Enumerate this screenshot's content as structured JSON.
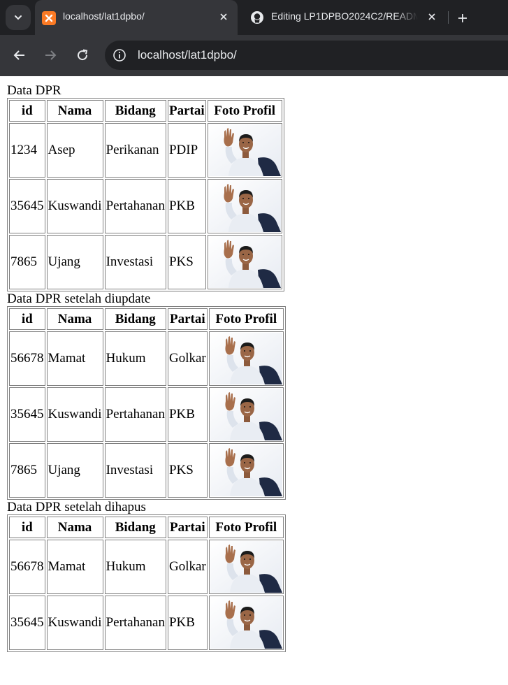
{
  "browser": {
    "tabs": [
      {
        "title": "localhost/lat1dpbo/",
        "active": true,
        "icon": "xampp-icon"
      },
      {
        "title": "Editing LP1DPBO2024C2/README.md",
        "active": false,
        "icon": "github-icon"
      }
    ],
    "url": "localhost/lat1dpbo/",
    "colors": {
      "chrome_bg": "#202124",
      "tab_active": "#35363a",
      "text": "#e8eaed",
      "xampp": "#fb7a24"
    }
  },
  "page": {
    "columns": [
      "id",
      "Nama",
      "Bidang",
      "Partai",
      "Foto Profil"
    ],
    "sections": [
      {
        "caption": "Data DPR",
        "rows": [
          {
            "id": "1234",
            "nama": "Asep",
            "bidang": "Perikanan",
            "partai": "PDIP"
          },
          {
            "id": "35645",
            "nama": "Kuswandi",
            "bidang": "Pertahanan",
            "partai": "PKB"
          },
          {
            "id": "7865",
            "nama": "Ujang",
            "bidang": "Investasi",
            "partai": "PKS"
          }
        ]
      },
      {
        "caption": "Data DPR setelah diupdate",
        "rows": [
          {
            "id": "56678",
            "nama": "Mamat",
            "bidang": "Hukum",
            "partai": "Golkar"
          },
          {
            "id": "35645",
            "nama": "Kuswandi",
            "bidang": "Pertahanan",
            "partai": "PKB"
          },
          {
            "id": "7865",
            "nama": "Ujang",
            "bidang": "Investasi",
            "partai": "PKS"
          }
        ]
      },
      {
        "caption": "Data DPR setelah dihapus",
        "rows": [
          {
            "id": "56678",
            "nama": "Mamat",
            "bidang": "Hukum",
            "partai": "Golkar"
          },
          {
            "id": "35645",
            "nama": "Kuswandi",
            "bidang": "Pertahanan",
            "partai": "PKB"
          }
        ]
      }
    ]
  }
}
